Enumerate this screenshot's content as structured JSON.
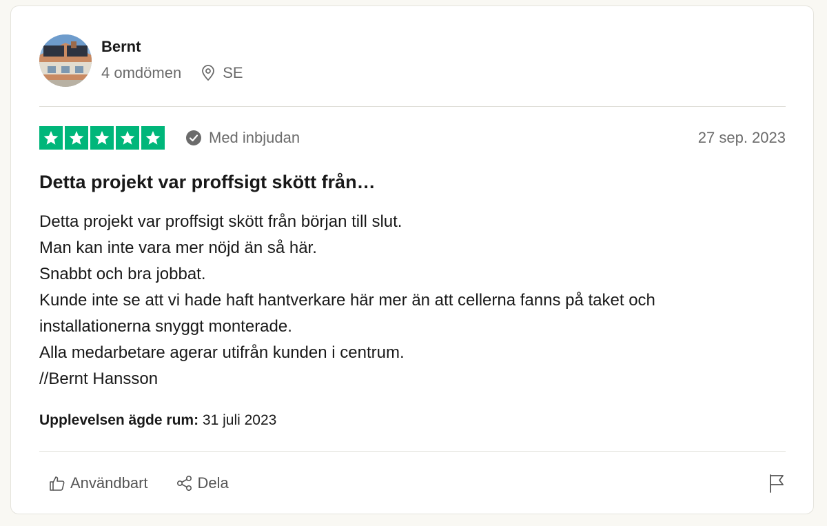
{
  "reviewer": {
    "name": "Bernt",
    "review_count": "4 omdömen",
    "country": "SE"
  },
  "review": {
    "rating": 5,
    "max_rating": 5,
    "verification_label": "Med inbjudan",
    "date": "27 sep. 2023",
    "title": "Detta projekt var proffsigt skött från…",
    "body_lines": [
      "Detta projekt var proffsigt skött från början till slut.",
      "Man kan inte vara mer nöjd än så här.",
      "Snabbt och bra jobbat.",
      "Kunde inte se att vi hade haft hantverkare här mer än att cellerna fanns på taket och",
      "installationerna snyggt monterade.",
      "Alla medarbetare agerar utifrån kunden i centrum.",
      "//Bernt Hansson"
    ],
    "experience_label": "Upplevelsen ägde rum:",
    "experience_date": "31 juli 2023"
  },
  "actions": {
    "useful_label": "Användbart",
    "share_label": "Dela"
  },
  "icons": {
    "location": "map-pin-icon",
    "verified": "check-circle-icon",
    "star": "star-icon",
    "useful": "thumbs-up-icon",
    "share": "share-icon",
    "report": "flag-icon"
  },
  "colors": {
    "star_green": "#00b67a",
    "muted_text": "#6b6b6b",
    "background": "#f9f8f3"
  }
}
